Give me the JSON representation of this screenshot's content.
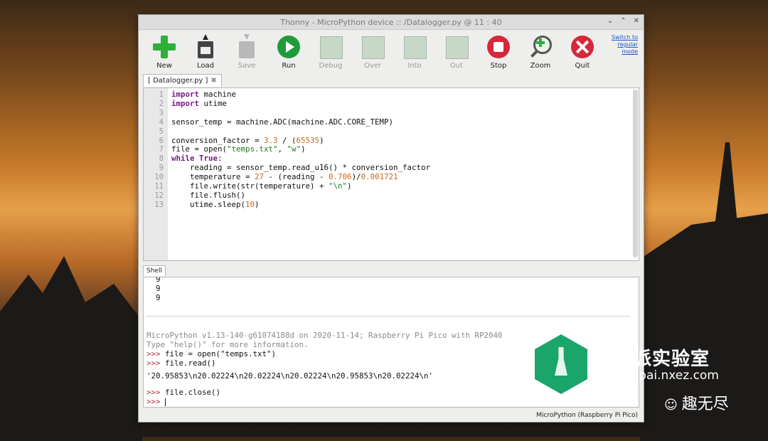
{
  "window": {
    "title": "Thonny  -  MicroPython device :: /Datalogger.py  @  11 : 40",
    "controls": [
      "⌄",
      "⌃",
      "✕"
    ]
  },
  "toolbar": {
    "new": "New",
    "load": "Load",
    "save": "Save",
    "run": "Run",
    "debug": "Debug",
    "over": "Over",
    "into": "Into",
    "out": "Out",
    "stop": "Stop",
    "zoom": "Zoom",
    "quit": "Quit",
    "switch_mode": "Switch to regular mode"
  },
  "editor": {
    "tab": "[ Datalogger.py ]",
    "lines": [
      "import machine",
      "import utime",
      "",
      "sensor_temp = machine.ADC(machine.ADC.CORE_TEMP)",
      "",
      "conversion_factor = 3.3 / (65535)",
      "file = open(\"temps.txt\", \"w\")",
      "while True:",
      "    reading = sensor_temp.read_u16() * conversion_factor",
      "    temperature = 27 - (reading - 0.706)/0.001721",
      "    file.write(str(temperature) + \"\\n\")",
      "    file.flush()",
      "    utime.sleep(10)"
    ],
    "line_numbers": [
      "1",
      "2",
      "3",
      "4",
      "5",
      "6",
      "7",
      "8",
      "9",
      "10",
      "11",
      "12",
      "13"
    ]
  },
  "shell": {
    "tab": "Shell",
    "top_lines": [
      "9",
      "9",
      "9"
    ],
    "banner": "MicroPython v1.13-140-g61074188d on 2020-11-14; Raspberry Pi Pico with RP2040",
    "help": "Type \"help()\" for more information.",
    "cmd1": "file = open(\"temps.txt\")",
    "cmd2": "file.read()",
    "output": "'20.95853\\n20.02224\\n20.02224\\n20.02224\\n20.95853\\n20.02224\\n'",
    "cmd3": "file.close()",
    "prompt": ">>>"
  },
  "status": "MicroPython (Raspberry Pi Pico)",
  "watermark": {
    "cn": "树莓派实验室",
    "url": "shumeipai.nxez.com",
    "wechat": "趣无尽"
  }
}
